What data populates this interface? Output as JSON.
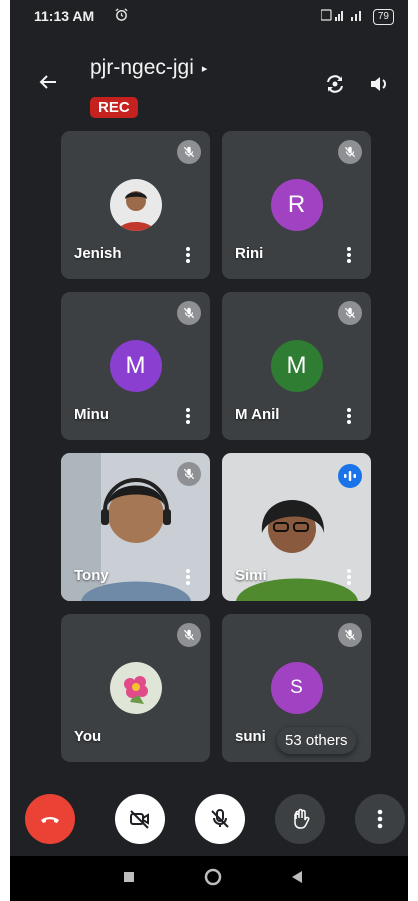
{
  "status_bar": {
    "time": "11:13 AM",
    "battery": "79"
  },
  "header": {
    "meeting_code": "pjr-ngec-jgi",
    "caret": "▸",
    "rec_label": "REC"
  },
  "participants": [
    {
      "name": "Jenish",
      "avatar_type": "photo",
      "muted": true
    },
    {
      "name": "Rini",
      "avatar_type": "letter",
      "letter": "R",
      "avatar_color": "#a142c3",
      "muted": true
    },
    {
      "name": "Minu",
      "avatar_type": "letter",
      "letter": "M",
      "avatar_color": "#8a3fd1",
      "muted": true
    },
    {
      "name": "M Anil",
      "avatar_type": "letter",
      "letter": "M",
      "avatar_color": "#2e7d32",
      "muted": true
    },
    {
      "name": "Tony",
      "avatar_type": "video",
      "muted": true
    },
    {
      "name": "Simi",
      "avatar_type": "video",
      "muted": false,
      "speaking": true
    },
    {
      "name": "You",
      "avatar_type": "photo",
      "muted": true
    },
    {
      "name": "suni",
      "avatar_type": "letter",
      "letter": "S",
      "avatar_color": "#a142c3",
      "muted": true
    }
  ],
  "others_pill": "53 others",
  "controls": {
    "end_call_color": "#ea4335",
    "camera_off": true,
    "mic_off": true
  },
  "colors": {
    "background": "#202124",
    "tile": "#3c4043",
    "accent": "#1a73e8",
    "rec": "#c5221f"
  },
  "icons": [
    "back-arrow-icon",
    "switch-camera-icon",
    "speaker-icon",
    "mic-off-icon",
    "video-off-icon",
    "hand-icon",
    "more-vert-icon",
    "end-call-icon",
    "alarm-icon",
    "signal-icon",
    "audio-wave-icon"
  ]
}
